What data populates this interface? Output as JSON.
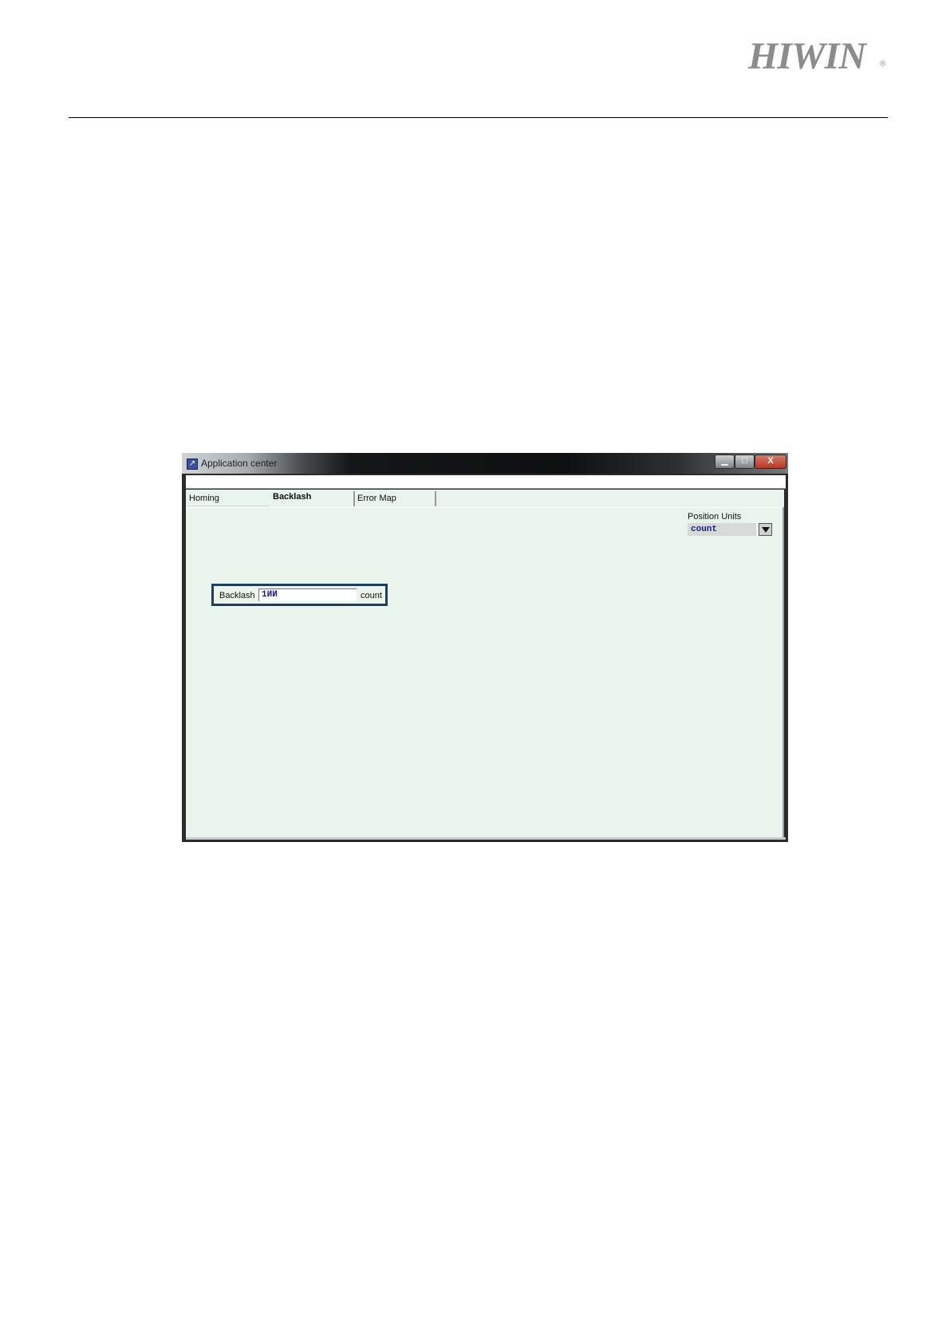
{
  "header": {
    "logo_text": "HIWIN",
    "logo_mark": "®"
  },
  "window": {
    "title": "Application center",
    "icon": "app-arrow-icon",
    "controls": [
      "minimize-icon",
      "maximize-icon",
      "close-icon"
    ],
    "close_glyph": "X"
  },
  "tabs": [
    {
      "label": "Homing",
      "active": false
    },
    {
      "label": "Backlash",
      "active": true
    },
    {
      "label": "Error Map",
      "active": false
    }
  ],
  "position_units": {
    "label": "Position Units",
    "selected": "count"
  },
  "backlash": {
    "label": "Backlash",
    "value": "1ИИ",
    "unit": "count"
  },
  "colors": {
    "client_background": "#e9f4ec",
    "highlight_border": "#1f3d5e",
    "value_text": "#1a1f7a"
  }
}
